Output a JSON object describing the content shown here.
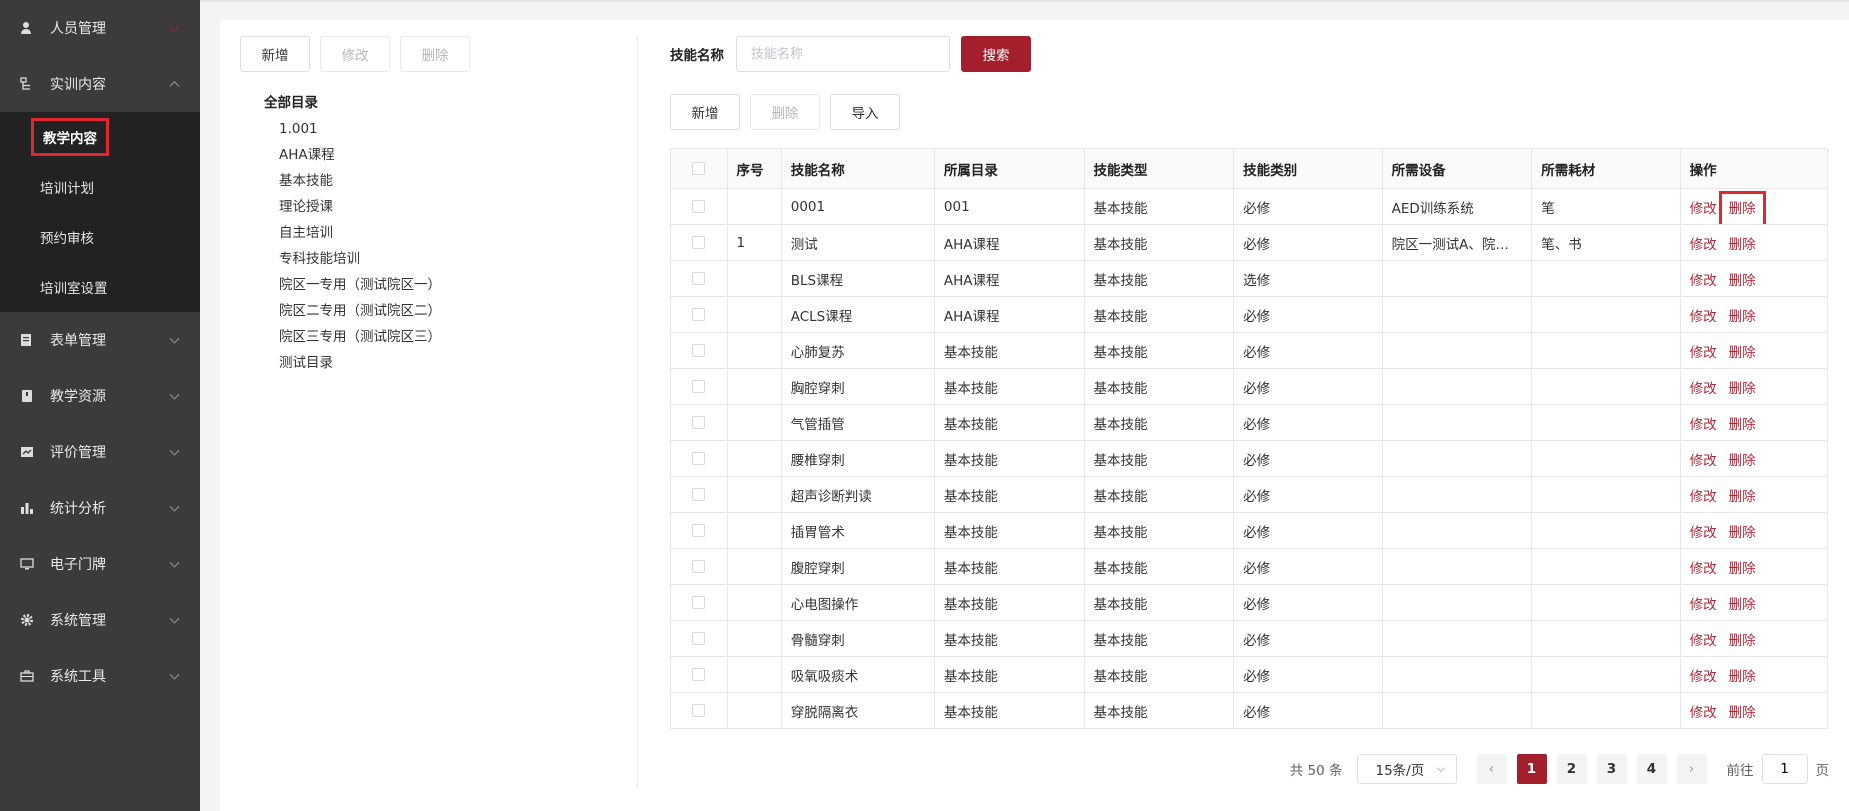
{
  "sidebar": {
    "items": [
      {
        "label": "人员管理",
        "icon": "user-icon",
        "expanded": false
      },
      {
        "label": "实训内容",
        "icon": "tree-icon",
        "expanded": true,
        "children": [
          {
            "label": "教学内容",
            "active": true
          },
          {
            "label": "培训计划"
          },
          {
            "label": "预约审核"
          },
          {
            "label": "培训室设置"
          }
        ]
      },
      {
        "label": "表单管理",
        "icon": "form-icon",
        "expanded": false
      },
      {
        "label": "教学资源",
        "icon": "resource-icon",
        "expanded": false
      },
      {
        "label": "评价管理",
        "icon": "evaluation-icon",
        "expanded": false
      },
      {
        "label": "统计分析",
        "icon": "bar-chart-icon",
        "expanded": false
      },
      {
        "label": "电子门牌",
        "icon": "monitor-icon",
        "expanded": false
      },
      {
        "label": "系统管理",
        "icon": "gear-icon",
        "expanded": false
      },
      {
        "label": "系统工具",
        "icon": "toolbox-icon",
        "expanded": false
      }
    ]
  },
  "left_panel": {
    "buttons": {
      "add": "新增",
      "edit": "修改",
      "delete": "删除"
    },
    "tree": {
      "root": "全部目录",
      "nodes": [
        "1.001",
        "AHA课程",
        "基本技能",
        "理论授课",
        "自主培训",
        "专科技能培训",
        "院区一专用（测试院区一）",
        "院区二专用（测试院区二）",
        "院区三专用（测试院区三）",
        "测试目录"
      ]
    }
  },
  "search": {
    "label": "技能名称",
    "placeholder": "技能名称",
    "button": "搜索"
  },
  "toolbar": {
    "add": "新增",
    "delete": "删除",
    "import": "导入"
  },
  "table": {
    "columns": [
      "序号",
      "技能名称",
      "所属目录",
      "技能类型",
      "技能类别",
      "所需设备",
      "所需耗材",
      "操作"
    ],
    "rows": [
      {
        "no": "",
        "name": "0001",
        "dir": "001",
        "type": "基本技能",
        "category": "必修",
        "device": "AED训练系统",
        "material": "笔"
      },
      {
        "no": "1",
        "name": "测试",
        "dir": "AHA课程",
        "type": "基本技能",
        "category": "必修",
        "device": "院区一测试A、院区一测试B",
        "material": "笔、书"
      },
      {
        "no": "",
        "name": "BLS课程",
        "dir": "AHA课程",
        "type": "基本技能",
        "category": "选修",
        "device": "",
        "material": ""
      },
      {
        "no": "",
        "name": "ACLS课程",
        "dir": "AHA课程",
        "type": "基本技能",
        "category": "必修",
        "device": "",
        "material": ""
      },
      {
        "no": "",
        "name": "心肺复苏",
        "dir": "基本技能",
        "type": "基本技能",
        "category": "必修",
        "device": "",
        "material": ""
      },
      {
        "no": "",
        "name": "胸腔穿刺",
        "dir": "基本技能",
        "type": "基本技能",
        "category": "必修",
        "device": "",
        "material": ""
      },
      {
        "no": "",
        "name": "气管插管",
        "dir": "基本技能",
        "type": "基本技能",
        "category": "必修",
        "device": "",
        "material": ""
      },
      {
        "no": "",
        "name": "腰椎穿刺",
        "dir": "基本技能",
        "type": "基本技能",
        "category": "必修",
        "device": "",
        "material": ""
      },
      {
        "no": "",
        "name": "超声诊断判读",
        "dir": "基本技能",
        "type": "基本技能",
        "category": "必修",
        "device": "",
        "material": ""
      },
      {
        "no": "",
        "name": "插胃管术",
        "dir": "基本技能",
        "type": "基本技能",
        "category": "必修",
        "device": "",
        "material": ""
      },
      {
        "no": "",
        "name": "腹腔穿刺",
        "dir": "基本技能",
        "type": "基本技能",
        "category": "必修",
        "device": "",
        "material": ""
      },
      {
        "no": "",
        "name": "心电图操作",
        "dir": "基本技能",
        "type": "基本技能",
        "category": "必修",
        "device": "",
        "material": ""
      },
      {
        "no": "",
        "name": "骨髓穿刺",
        "dir": "基本技能",
        "type": "基本技能",
        "category": "必修",
        "device": "",
        "material": ""
      },
      {
        "no": "",
        "name": "吸氧吸痰术",
        "dir": "基本技能",
        "type": "基本技能",
        "category": "必修",
        "device": "",
        "material": ""
      },
      {
        "no": "",
        "name": "穿脱隔离衣",
        "dir": "基本技能",
        "type": "基本技能",
        "category": "必修",
        "device": "",
        "material": ""
      }
    ],
    "actions": {
      "edit": "修改",
      "delete": "删除"
    }
  },
  "pagination": {
    "total": "共 50 条",
    "page_size": "15条/页",
    "pages": [
      "1",
      "2",
      "3",
      "4"
    ],
    "current": "1",
    "prev": "‹",
    "next": "›",
    "goto_prefix": "前往",
    "goto_value": "1",
    "goto_suffix": "页"
  },
  "colors": {
    "accent": "#a31f2c",
    "sidebar_bg": "#3b3b3b",
    "submenu_bg": "#222222",
    "highlight": "#e0262f"
  }
}
